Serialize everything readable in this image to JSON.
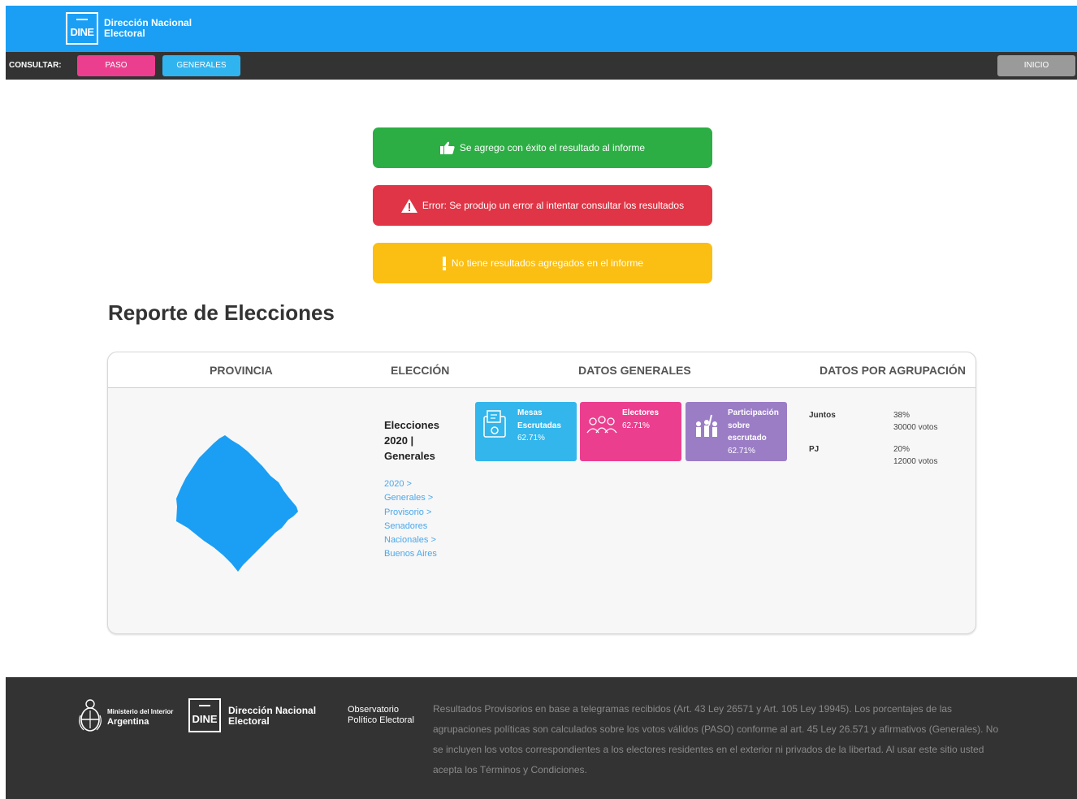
{
  "header": {
    "logo_mark": "DINE",
    "logo_line1": "Dirección Nacional",
    "logo_line2": "Electoral"
  },
  "nav": {
    "label": "CONSULTAR:",
    "paso": "PASO",
    "generales": "GENERALES",
    "inicio": "INICIO"
  },
  "alerts": {
    "success": "Se agrego con éxito el resultado al informe",
    "error": "Error: Se produjo un error al intentar consultar los resultados",
    "warning": "No tiene resultados agregados en el informe"
  },
  "report": {
    "title": "Reporte de Elecciones",
    "headers": {
      "provincia": "PROVINCIA",
      "eleccion": "ELECCIÓN",
      "datos_generales": "DATOS GENERALES",
      "datos_agrupacion": "DATOS POR AGRUPACIÓN"
    },
    "election": {
      "line1": "Elecciones",
      "line2": "2020 |",
      "line3": "Generales"
    },
    "breadcrumb": [
      "2020 >",
      "Generales >",
      "Provisorio >",
      "Senadores",
      "Nacionales >",
      "Buenos Aires"
    ],
    "cards": {
      "mesas": {
        "l1": "Mesas",
        "l2": "Escrutadas",
        "value": "62.71%"
      },
      "electores": {
        "l1": "Electores",
        "value": "62.71%"
      },
      "participacion": {
        "l1": "Participación",
        "l2": "sobre",
        "l3": "escrutado",
        "value": "62.71%"
      }
    },
    "agrupaciones": [
      {
        "name": "Juntos",
        "pct": "38%",
        "votos": "30000 votos"
      },
      {
        "name": "PJ",
        "pct": "20%",
        "votos": "12000 votos"
      }
    ]
  },
  "footer": {
    "ministerio_line1": "Ministerio del Interior",
    "ministerio_line2": "Argentina",
    "logo_mark": "DINE",
    "logo_line1": "Dirección Nacional",
    "logo_line2": "Electoral",
    "obs_line1": "Observatorio",
    "obs_line2": "Político Electoral",
    "disclaimer": "Resultados Provisorios en base a telegramas recibidos (Art. 43 Ley 26571 y Art. 105 Ley 19945). Los porcentajes de las agrupaciones políticas son calculados sobre los votos válidos (PASO) conforme al art. 45 Ley 26.571 y afirmativos (Generales). No se incluyen los votos correspondientes a los electores residentes en el exterior ni privados de la libertad. Al usar este sitio usted acepta los Términos y Condiciones."
  },
  "colors": {
    "header_blue": "#1a9ff5",
    "nav_dark": "#333333",
    "paso_pink": "#ec3e8f",
    "generales_blue": "#2fb4f0",
    "success_green": "#2cae44",
    "error_red": "#e03546",
    "warning_yellow": "#fbbe13",
    "participacion_purple": "#9b7dc6",
    "map_blue": "#1a9ff5"
  },
  "icons": {
    "success": "thumbs-up-icon",
    "error": "warning-triangle-icon",
    "warning": "exclamation-icon",
    "mesas": "ballot-box-icon",
    "electores": "people-icon",
    "participacion": "raised-hands-icon"
  }
}
